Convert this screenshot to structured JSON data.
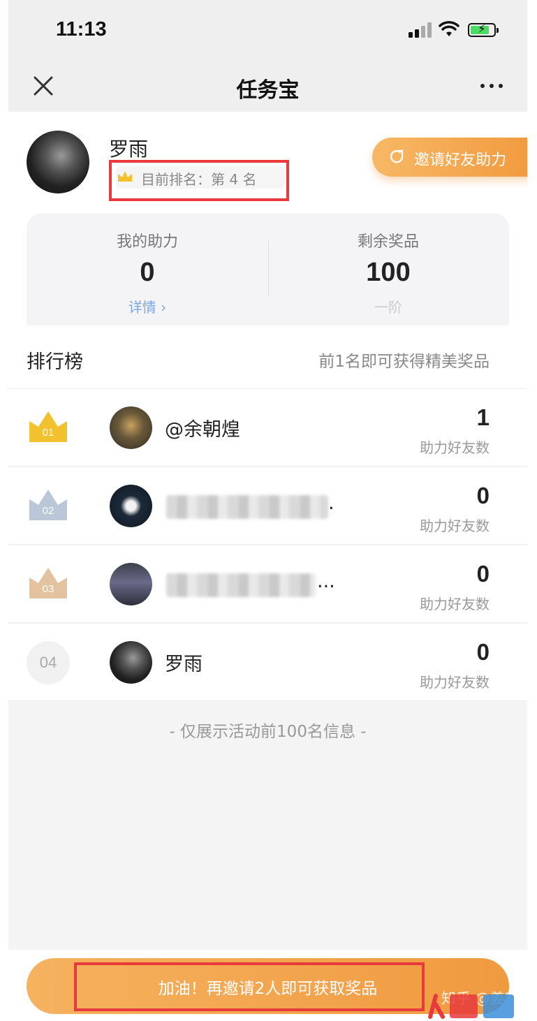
{
  "status_bar": {
    "time": "11:13"
  },
  "nav": {
    "title": "任务宝"
  },
  "profile": {
    "name": "罗雨",
    "rank_text": "目前排名：第 4 名",
    "invite_button": "邀请好友助力"
  },
  "stats": {
    "my_help_label": "我的助力",
    "my_help_value": "0",
    "detail_link": "详情",
    "remaining_label": "剩余奖品",
    "remaining_value": "100",
    "remaining_tier": "一阶"
  },
  "leaderboard": {
    "title": "排行榜",
    "hint": "前1名即可获得精美奖品",
    "rows": [
      {
        "rank": "01",
        "name": "@余朝煌",
        "count": "1",
        "count_label": "助力好友数",
        "crown_color": "#f2c12e"
      },
      {
        "rank": "02",
        "name": "",
        "name_tail": ".",
        "count": "0",
        "count_label": "助力好友数",
        "crown_color": "#b9c7d8"
      },
      {
        "rank": "03",
        "name": "",
        "name_tail": "...",
        "count": "0",
        "count_label": "助力好友数",
        "crown_color": "#e2c29f"
      },
      {
        "rank": "04",
        "name": "罗雨",
        "count": "0",
        "count_label": "助力好友数"
      }
    ],
    "footer_note": "- 仅展示活动前100名信息 -"
  },
  "cta": {
    "label": "加油！再邀请2人即可获取奖品"
  },
  "watermark": {
    "text": "知乎 @姜宇"
  },
  "colors": {
    "accent": "#f29a3e",
    "highlight_border": "#e8393c",
    "link": "#7aa6e6"
  }
}
